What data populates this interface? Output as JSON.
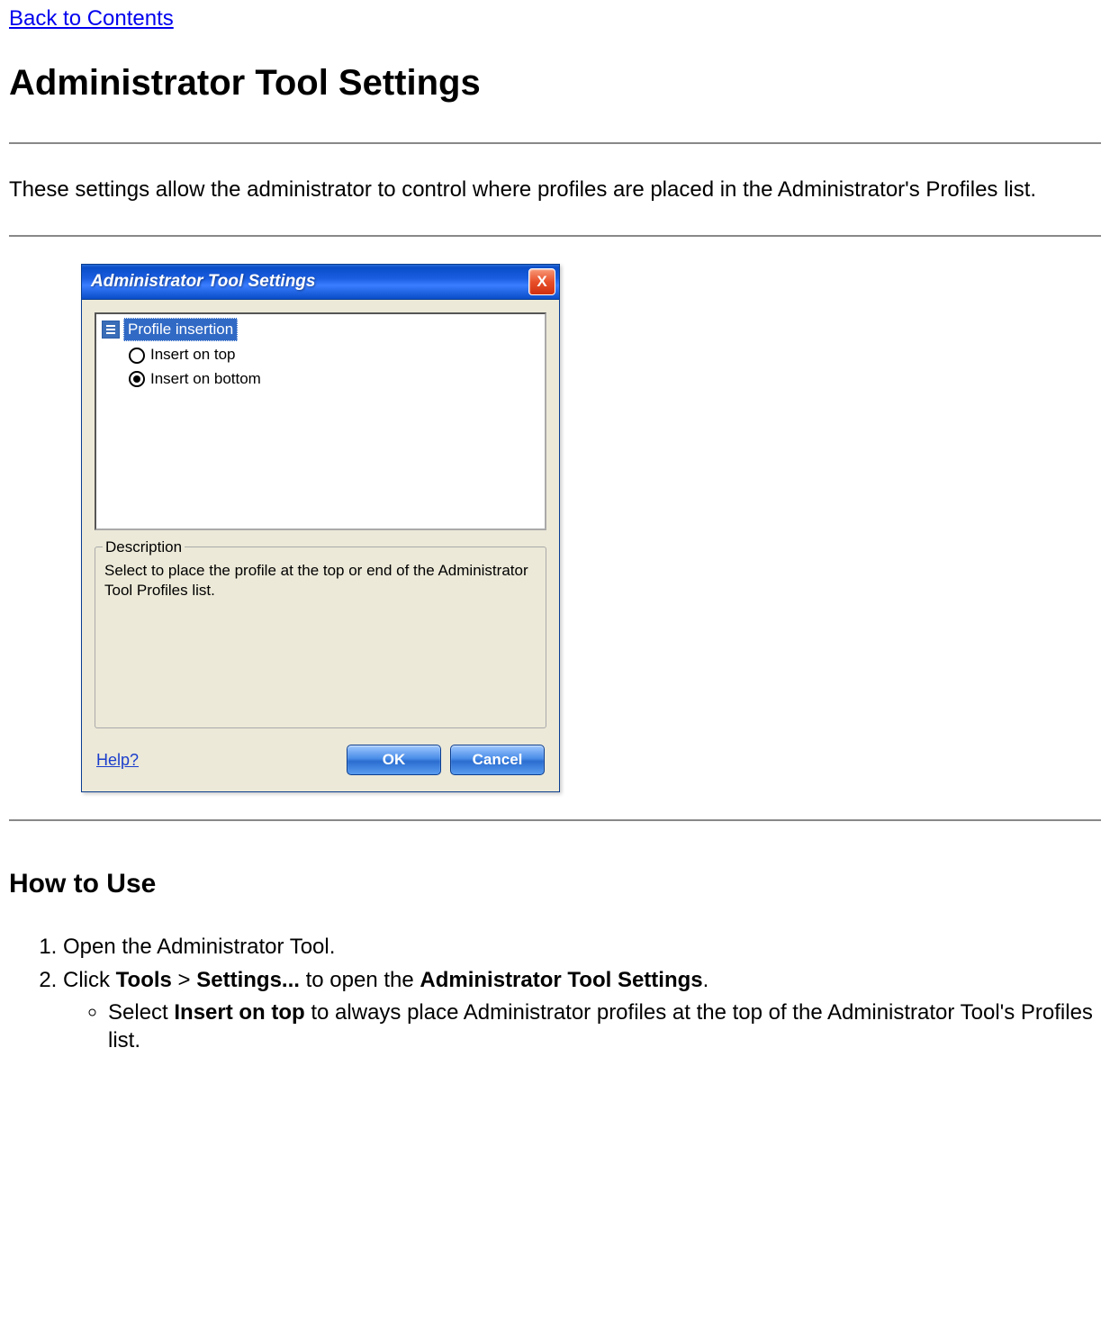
{
  "nav": {
    "back_link": "Back to Contents"
  },
  "page": {
    "title": "Administrator Tool Settings",
    "intro": "These settings allow the administrator to control where profiles are placed in the Administrator's Profiles list."
  },
  "dialog": {
    "title": "Administrator Tool Settings",
    "close_glyph": "X",
    "list_header": "Profile insertion",
    "radio_top": "Insert on top",
    "radio_bottom": "Insert on bottom",
    "selected_option": "bottom",
    "description_label": "Description",
    "description_text": "Select to place the profile at the top or end of the Administrator Tool Profiles list.",
    "help_label": "Help?",
    "ok_label": "OK",
    "cancel_label": "Cancel"
  },
  "howto": {
    "heading": "How to Use",
    "step1": "Open the Administrator Tool.",
    "step2_prefix": "Click ",
    "step2_tools": "Tools",
    "step2_gt": " > ",
    "step2_settings": "Settings...",
    "step2_mid": " to open the ",
    "step2_ats": "Administrator Tool Settings",
    "step2_suffix": ".",
    "sub1_prefix": "Select ",
    "sub1_bold": "Insert on top",
    "sub1_suffix": " to always place Administrator profiles at the top of the Administrator Tool's Profiles list."
  }
}
